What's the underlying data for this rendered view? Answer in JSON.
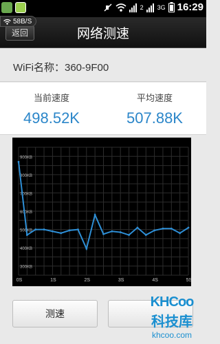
{
  "status_bar": {
    "time": "16:29",
    "network": "3G",
    "sim_slot": "2"
  },
  "header": {
    "back_label": "返回",
    "title": "网络测速",
    "rate_badge": "58B/S"
  },
  "wifi": {
    "name_text": "WiFi名称：360-9F00"
  },
  "speeds": {
    "current_label": "当前速度",
    "current_value": "498.52K",
    "average_label": "平均速度",
    "average_value": "507.88K",
    "value_color": "#2b86c9"
  },
  "chart_data": {
    "type": "line",
    "x_ticks": [
      "0S",
      "1S",
      "2S",
      "3S",
      "4S",
      "5S"
    ],
    "y_ticks": [
      "300KB",
      "400KB",
      "500KB",
      "600KB",
      "700KB",
      "800KB",
      "900KB"
    ],
    "ylim": [
      250,
      950
    ],
    "xlim": [
      0,
      10
    ],
    "grid": true,
    "line_color": "#2e8fd6",
    "series": [
      {
        "x": [
          0,
          0.5,
          1,
          1.5,
          2,
          2.5,
          3,
          3.5,
          4,
          4.5,
          5,
          5.5,
          6,
          6.5,
          7,
          7.5,
          8,
          8.5,
          9,
          9.5,
          10
        ],
        "values": [
          870,
          470,
          500,
          500,
          490,
          480,
          495,
          500,
          395,
          580,
          475,
          490,
          485,
          470,
          510,
          470,
          495,
          505,
          505,
          480,
          510
        ]
      }
    ]
  },
  "actions": {
    "test_label": "测速"
  },
  "watermark": {
    "logo": "KHCoo",
    "name": "科技库",
    "url": "khcoo.com"
  }
}
